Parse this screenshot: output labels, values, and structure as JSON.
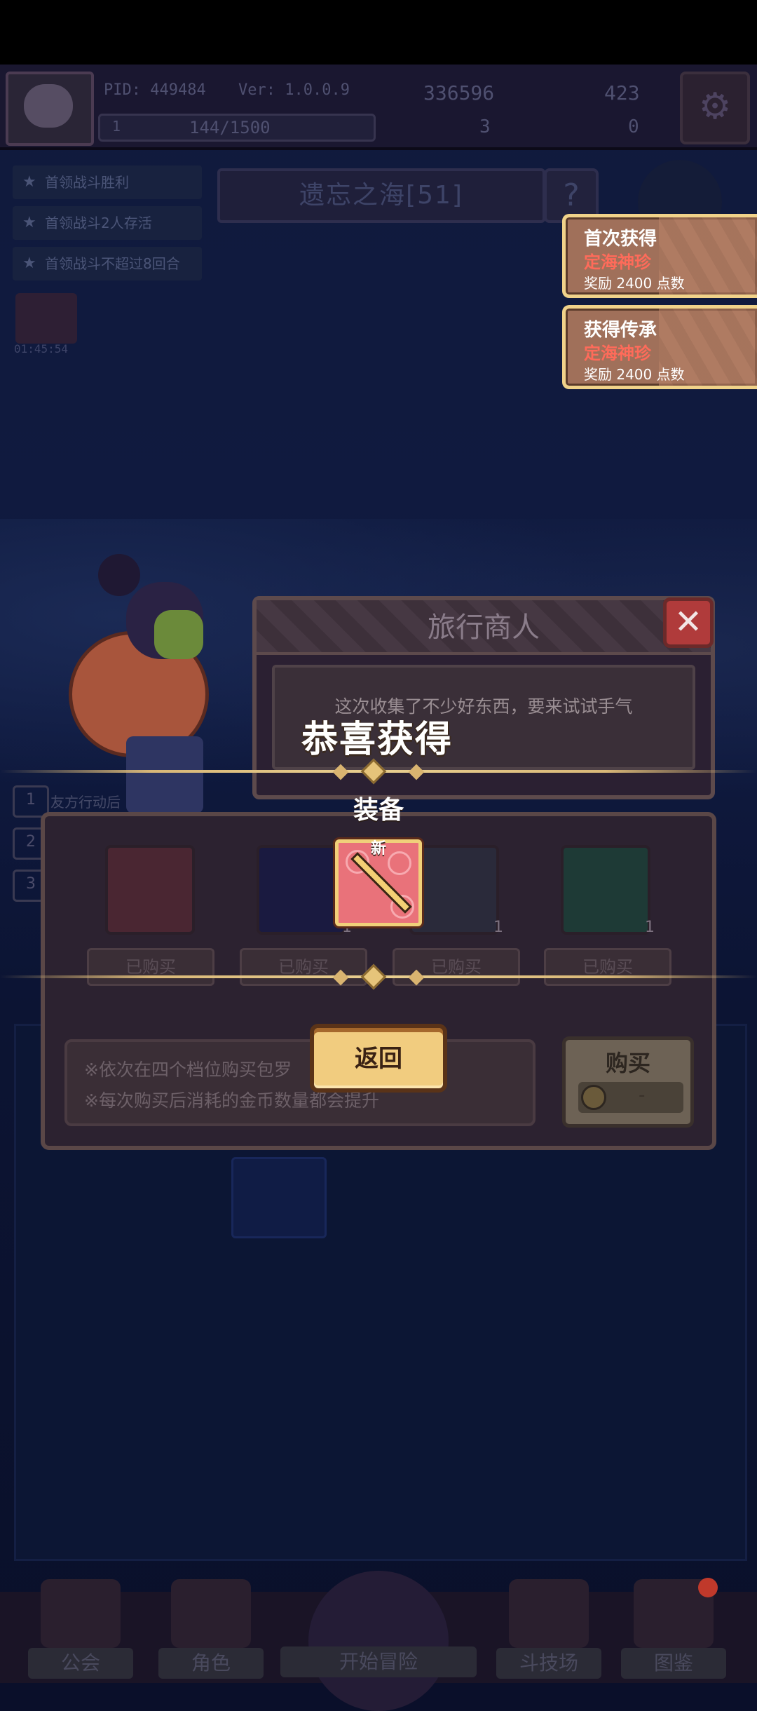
{
  "hud": {
    "pid": "PID: 449484",
    "version": "Ver: 1.0.0.9",
    "coins": "336596",
    "gems": "423",
    "energy": "144/1500",
    "energy_level": "1",
    "clover": "3",
    "keys": "0"
  },
  "quests": [
    "首领战斗胜利",
    "首领战斗2人存活",
    "首领战斗不超过8回合"
  ],
  "stage": {
    "title": "遗忘之海[51]",
    "help_icon": "?"
  },
  "timer": "01:45:54",
  "toasts": [
    {
      "line1": "首次获得",
      "line2": "定海神珍",
      "line3": "奖励 2400 点数"
    },
    {
      "line1": "获得传承",
      "line2": "定海神珍",
      "line3": "奖励 2400 点数"
    }
  ],
  "merchant": {
    "title": "旅行商人",
    "message": "这次收集了不少好东西，要来试试手气",
    "close_icon": "✕"
  },
  "battle_list": [
    {
      "num": "1",
      "text": "友方行动后"
    },
    {
      "num": "2",
      "text": ""
    },
    {
      "num": "3",
      "text": ""
    }
  ],
  "shop": {
    "slots": [
      {
        "label": "已购买",
        "qty": ""
      },
      {
        "label": "已购买",
        "qty": "1"
      },
      {
        "label": "已购买",
        "qty": "1"
      },
      {
        "label": "已购买",
        "qty": "1"
      }
    ],
    "tips": [
      "※依次在四个档位购买包罗",
      "※每次购买后消耗的金币数量都会提升"
    ],
    "buy_label": "购买",
    "price": "-"
  },
  "reward": {
    "title": "恭喜获得",
    "category": "装备",
    "new_badge": "新",
    "back_label": "返回"
  },
  "nav": [
    "公会",
    "角色",
    "开始冒险",
    "斗技场",
    "图鉴"
  ],
  "colors": {
    "reward_red": "#ff6b5a",
    "gold_frame": "#f0d28a",
    "item_bg": "#e9727a"
  }
}
